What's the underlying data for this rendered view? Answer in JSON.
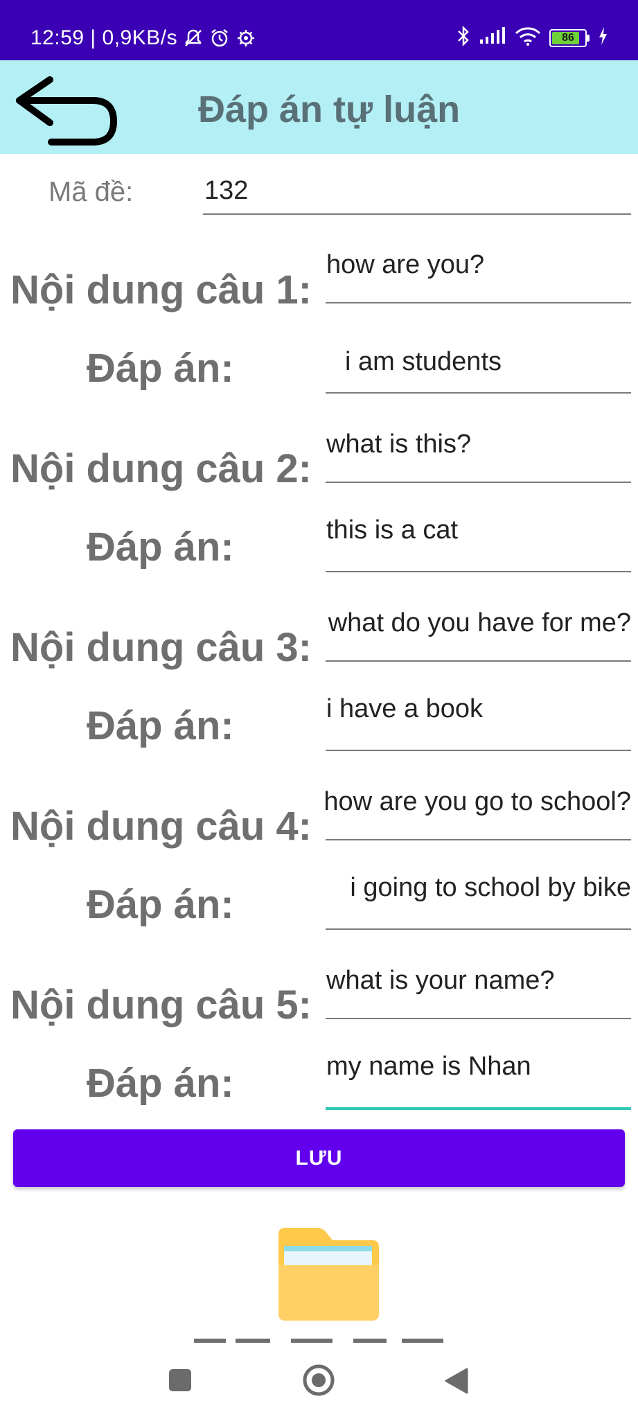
{
  "status_bar": {
    "time_speed": "12:59 | 0,9KB/s",
    "battery_level": "86",
    "battery_percent": 86,
    "icons": [
      "mute-bell-icon",
      "alarm-icon",
      "settings-gear-icon",
      "bluetooth-icon",
      "signal-icon",
      "wifi-icon",
      "battery-icon",
      "charging-icon"
    ]
  },
  "header": {
    "title": "Đáp án tự luận",
    "back_icon": "back-arrow-icon"
  },
  "form": {
    "exam_code_label": "Mã đề:",
    "exam_code_value": "132",
    "questions": [
      {
        "question_label": "Nội dung câu 1:",
        "question_value": "how are you?",
        "answer_label": "Đáp án:",
        "answer_value": "i am students"
      },
      {
        "question_label": "Nội dung câu 2:",
        "question_value": "what is this?",
        "answer_label": "Đáp án:",
        "answer_value": "this is a cat"
      },
      {
        "question_label": "Nội dung câu 3:",
        "question_value": "what do you have for me?",
        "answer_label": "Đáp án:",
        "answer_value": "i have a book"
      },
      {
        "question_label": "Nội dung câu 4:",
        "question_value": "how are you go to school?",
        "answer_label": "Đáp án:",
        "answer_value": "i going to school by bike"
      },
      {
        "question_label": "Nội dung câu 5:",
        "question_value": "what is your name?",
        "answer_label": "Đáp án:",
        "answer_value": "my name is Nhan"
      }
    ],
    "save_label": "LƯU"
  },
  "colors": {
    "status_bar": "#3b00b3",
    "app_bar": "#b3eff5",
    "primary_button": "#6200ee",
    "focus_underline": "#2fc9b6",
    "folder": "#ffd066"
  }
}
